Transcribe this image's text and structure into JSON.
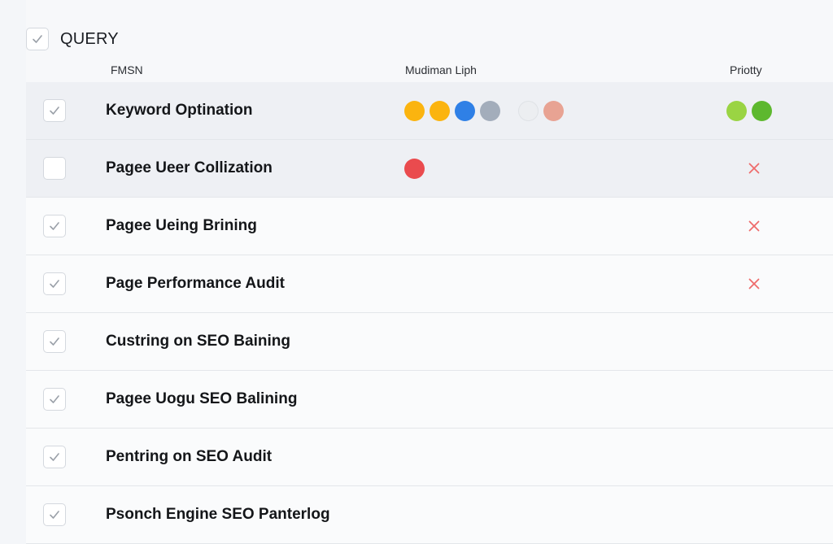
{
  "query": {
    "label": "QUERY",
    "checked": true
  },
  "columns": {
    "name": "FMSN",
    "middle": "Mudiman Liph",
    "priority": "Priotty"
  },
  "colors": {
    "amber": "#fbb40f",
    "blue": "#2f80e6",
    "grey": "#a3adbb",
    "light": "#eceef1",
    "salmon": "#e8a393",
    "red": "#ea4b4e",
    "lime": "#9ad443",
    "green": "#5db82e",
    "x_red": "#ee6c6c"
  },
  "rows": [
    {
      "title": "Keyword Optination",
      "checked": true,
      "highlight": true,
      "dots": [
        "#fbb40f",
        "#fbb40f",
        "#2f80e6",
        "#a3adbb",
        "#eceef1",
        "#e8a393"
      ],
      "priority_dots": [
        "#9ad443",
        "#5db82e"
      ],
      "priority_icon": null
    },
    {
      "title": "Pagee Ueer Collization",
      "checked": false,
      "highlight": true,
      "dots": [
        "#ea4b4e"
      ],
      "priority_dots": [],
      "priority_icon": "close-icon"
    },
    {
      "title": "Pagee Ueing Brining",
      "checked": true,
      "highlight": false,
      "dots": [],
      "priority_dots": [],
      "priority_icon": "close-icon"
    },
    {
      "title": "Page Performance Audit",
      "checked": true,
      "highlight": false,
      "dots": [],
      "priority_dots": [],
      "priority_icon": "close-icon"
    },
    {
      "title": "Custring on SEO Baining",
      "checked": true,
      "highlight": false,
      "dots": [],
      "priority_dots": [],
      "priority_icon": null
    },
    {
      "title": "Pagee Uogu SEO Balining",
      "checked": true,
      "highlight": false,
      "dots": [],
      "priority_dots": [],
      "priority_icon": null
    },
    {
      "title": "Pentring on SEO Audit",
      "checked": true,
      "highlight": false,
      "dots": [],
      "priority_dots": [],
      "priority_icon": null
    },
    {
      "title": "Psonch Engine SEO Panterlog",
      "checked": true,
      "highlight": false,
      "dots": [],
      "priority_dots": [],
      "priority_icon": null
    }
  ]
}
